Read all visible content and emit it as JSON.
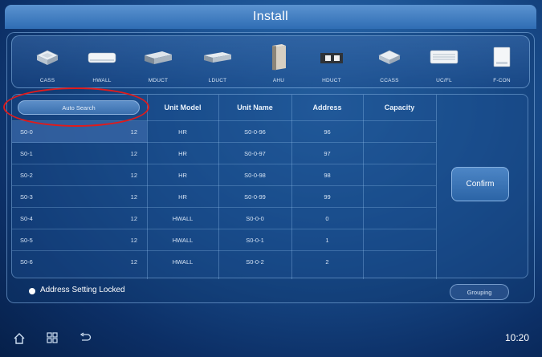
{
  "window": {
    "title": "Install"
  },
  "devices": [
    {
      "label": "CASS",
      "icon": "cassette-unit-icon"
    },
    {
      "label": "HWALL",
      "icon": "wall-unit-icon"
    },
    {
      "label": "MDUCT",
      "icon": "medium-duct-icon"
    },
    {
      "label": "LDUCT",
      "icon": "low-duct-icon"
    },
    {
      "label": "AHU",
      "icon": "air-handling-unit-icon"
    },
    {
      "label": "HDUCT",
      "icon": "high-duct-icon"
    },
    {
      "label": "CCASS",
      "icon": "compact-cassette-icon"
    },
    {
      "label": "UC/FL",
      "icon": "ceiling-floor-unit-icon"
    },
    {
      "label": "F-CON",
      "icon": "floor-console-icon"
    }
  ],
  "auto_search": {
    "label": "Auto Search"
  },
  "table": {
    "columns": [
      "Unit Model",
      "Unit Name",
      "Address",
      "Capacity"
    ],
    "rows": [
      {
        "group": "S0-0",
        "count": "12",
        "model": "HR",
        "name": "S0-0-96",
        "address": "96",
        "capacity": ""
      },
      {
        "group": "S0-1",
        "count": "12",
        "model": "HR",
        "name": "S0-0-97",
        "address": "97",
        "capacity": ""
      },
      {
        "group": "S0-2",
        "count": "12",
        "model": "HR",
        "name": "S0-0-98",
        "address": "98",
        "capacity": ""
      },
      {
        "group": "S0-3",
        "count": "12",
        "model": "HR",
        "name": "S0-0-99",
        "address": "99",
        "capacity": ""
      },
      {
        "group": "S0-4",
        "count": "12",
        "model": "HWALL",
        "name": "S0-0-0",
        "address": "0",
        "capacity": ""
      },
      {
        "group": "S0-5",
        "count": "12",
        "model": "HWALL",
        "name": "S0-0-1",
        "address": "1",
        "capacity": ""
      },
      {
        "group": "S0-6",
        "count": "12",
        "model": "HWALL",
        "name": "S0-0-2",
        "address": "2",
        "capacity": ""
      }
    ]
  },
  "buttons": {
    "confirm": "Confirm",
    "grouping": "Grouping"
  },
  "status": {
    "text": "Address Setting Locked"
  },
  "clock": "10:20",
  "nav": [
    "home-icon",
    "grid-icon",
    "back-icon"
  ]
}
